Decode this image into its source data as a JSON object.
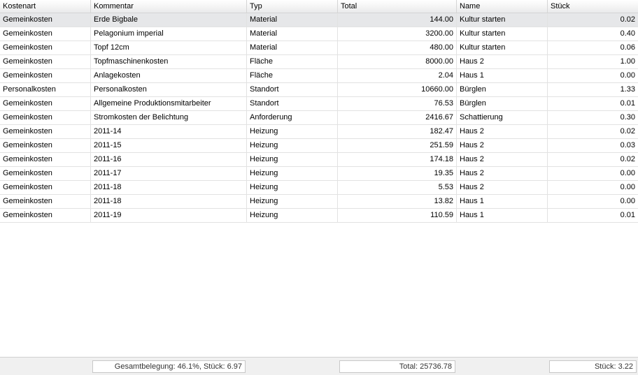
{
  "table": {
    "columns": [
      "Kostenart",
      "Kommentar",
      "Typ",
      "Total",
      "Name",
      "Stück"
    ],
    "rows": [
      [
        "Gemeinkosten",
        "Erde Bigbale",
        "Material",
        "144.00",
        "Kultur starten",
        "0.02"
      ],
      [
        "Gemeinkosten",
        "Pelagonium imperial",
        "Material",
        "3200.00",
        "Kultur starten",
        "0.40"
      ],
      [
        "Gemeinkosten",
        "Topf 12cm",
        "Material",
        "480.00",
        "Kultur starten",
        "0.06"
      ],
      [
        "Gemeinkosten",
        "Topfmaschinenkosten",
        "Fläche",
        "8000.00",
        "Haus 2",
        "1.00"
      ],
      [
        "Gemeinkosten",
        "Anlagekosten",
        "Fläche",
        "2.04",
        "Haus 1",
        "0.00"
      ],
      [
        "Personalkosten",
        "Personalkosten",
        "Standort",
        "10660.00",
        "Bürglen",
        "1.33"
      ],
      [
        "Gemeinkosten",
        "Allgemeine Produktionsmitarbeiter",
        "Standort",
        "76.53",
        "Bürglen",
        "0.01"
      ],
      [
        "Gemeinkosten",
        "Stromkosten der Belichtung",
        "Anforderung",
        "2416.67",
        "Schattierung",
        "0.30"
      ],
      [
        "Gemeinkosten",
        "2011-14",
        "Heizung",
        "182.47",
        "Haus 2",
        "0.02"
      ],
      [
        "Gemeinkosten",
        "2011-15",
        "Heizung",
        "251.59",
        "Haus 2",
        "0.03"
      ],
      [
        "Gemeinkosten",
        "2011-16",
        "Heizung",
        "174.18",
        "Haus 2",
        "0.02"
      ],
      [
        "Gemeinkosten",
        "2011-17",
        "Heizung",
        "19.35",
        "Haus 2",
        "0.00"
      ],
      [
        "Gemeinkosten",
        "2011-18",
        "Heizung",
        "5.53",
        "Haus 2",
        "0.00"
      ],
      [
        "Gemeinkosten",
        "2011-18",
        "Heizung",
        "13.82",
        "Haus 1",
        "0.00"
      ],
      [
        "Gemeinkosten",
        "2011-19",
        "Heizung",
        "110.59",
        "Haus 1",
        "0.01"
      ]
    ],
    "selected_row": 0
  },
  "footer": {
    "belegung": "Gesamtbelegung: 46.1%, Stück: 6.97",
    "total": "Total: 25736.78",
    "stueck": "Stück: 3.22"
  }
}
